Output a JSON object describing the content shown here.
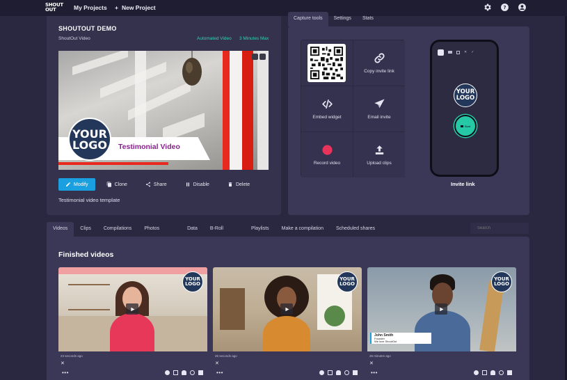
{
  "nav": {
    "logo_line1": "SHOUT",
    "logo_line2": "OUT",
    "my_projects": "My Projects",
    "new_project": "New Project"
  },
  "project": {
    "title": "SHOUTOUT DEMO",
    "subtitle": "ShoutOut Video",
    "tag_type": "Automated Video",
    "tag_length": "3 Minutes Max",
    "template_label": "Testimonial video template",
    "preview": {
      "logo_line1": "YOUR",
      "logo_line2": "LOGO",
      "banner_text": "Testimonial Video"
    },
    "actions": [
      {
        "label": "Modify",
        "icon": "pencil-icon"
      },
      {
        "label": "Clone",
        "icon": "copy-icon"
      },
      {
        "label": "Share",
        "icon": "share-icon"
      },
      {
        "label": "Disable",
        "icon": "pause-icon"
      },
      {
        "label": "Delete",
        "icon": "trash-icon"
      }
    ]
  },
  "right_tabs": [
    "Capture tools",
    "Settings",
    "Stats"
  ],
  "tools": {
    "copy_invite": "Copy invite link",
    "embed_widget": "Embed widget",
    "email_invite": "Email invite",
    "record_video": "Record video",
    "upload_clips": "Upload clips",
    "record_color": "#e8345a"
  },
  "phone": {
    "logo_line1": "YOUR",
    "logo_line2": "LOGO",
    "start_label": "Start",
    "invite_link": "Invite link"
  },
  "bottom_tabs": [
    "Videos",
    "Clips",
    "Compilations",
    "Photos",
    "Data",
    "B-Roll",
    "Playlists",
    "Make a compilation",
    "Scheduled shares"
  ],
  "search": {
    "placeholder": "Search"
  },
  "finished": {
    "title": "Finished videos",
    "videos": [
      {
        "ago": "23 seconds ago",
        "logo1": "YOUR",
        "logo2": "LOGO"
      },
      {
        "ago": "26 seconds ago",
        "logo1": "YOUR",
        "logo2": "LOGO"
      },
      {
        "ago": "26 minutes ago",
        "logo1": "YOUR",
        "logo2": "LOGO",
        "name": "John Smith",
        "role": "Founder",
        "company": "We love ShoutOut"
      }
    ]
  },
  "colors": {
    "accent": "#1aa0e0",
    "teal": "#26c9a6",
    "bg": "#2a2841",
    "panel": "#3a3856"
  }
}
